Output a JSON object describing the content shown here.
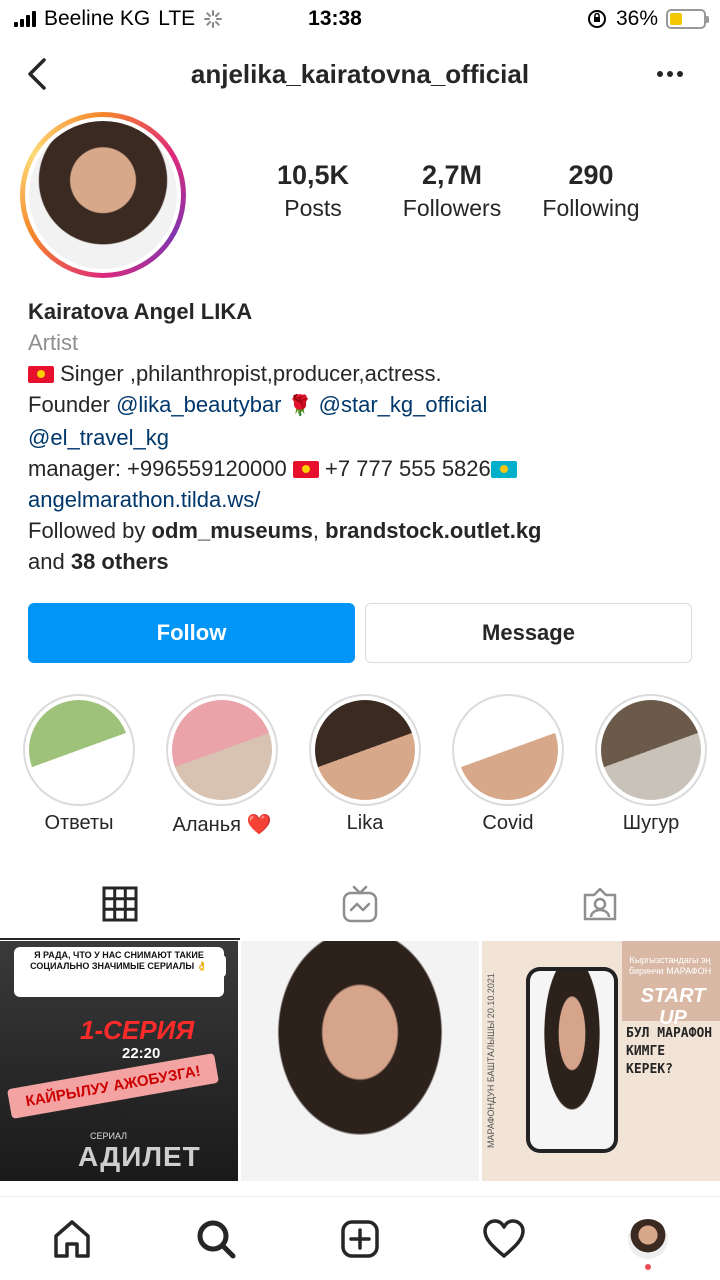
{
  "status_bar": {
    "carrier": "Beeline KG",
    "network": "LTE",
    "time": "13:38",
    "battery": "36%",
    "battery_level": 0.36
  },
  "header": {
    "username": "anjelika_kairatovna_official"
  },
  "stats": [
    {
      "value": "10,5K",
      "label": "Posts"
    },
    {
      "value": "2,7M",
      "label": "Followers"
    },
    {
      "value": "290",
      "label": "Following"
    }
  ],
  "bio": {
    "name": "Kairatova Angel LIKA",
    "category": "Artist",
    "line1": "Singer ,philanthropist,producer,actress.",
    "founder": "Founder",
    "mention1": "@lika_beautybar",
    "mention2": "@star_kg_official",
    "mention3": "@el_travel_kg",
    "manager_prefix": "manager: +996559120000",
    "manager_phone2": "+7 777 555 5826",
    "website": "angelmarathon.tilda.ws/",
    "followed_by_prefix": "Followed by",
    "followed_user1": "odm_museums",
    "followed_user2": "brandstock.outlet.kg",
    "and": "and",
    "others": "38 others"
  },
  "buttons": {
    "follow": "Follow",
    "message": "Message"
  },
  "highlights": [
    {
      "label": "Ответы",
      "colors": [
        "#9fc27a",
        "#ffffff"
      ]
    },
    {
      "label": "Аланья ❤️",
      "colors": [
        "#e9a3a9",
        "#d8c3b3"
      ]
    },
    {
      "label": "Lika",
      "colors": [
        "#3b2a22",
        "#d8a88a"
      ]
    },
    {
      "label": "Covid",
      "colors": [
        "#ffffff",
        "#d8a88a"
      ]
    },
    {
      "label": "Шугур",
      "colors": [
        "#6b5a4a",
        "#c9c2b8"
      ]
    }
  ],
  "posts": {
    "post1": {
      "top_text": "Я РАДА, ЧТО У НАС СНИМАЮТ ТАКИЕ СОЦИАЛЬНО ЗНАЧИМЫЕ СЕРИАЛЫ 👌",
      "episode": "1-СЕРИЯ",
      "time": "22:20",
      "banner": "КАЙРЫЛУУ АЖОБУЗГА!",
      "sub": "СЕРИАЛ",
      "series": "АДИЛЕТ"
    },
    "post3": {
      "vertical": "МАРАФОНДУН БАШТАЛЫШЫ 20.10.2021",
      "top": "Кыргызстандагы эң биринчи МАРАФОН",
      "start": "START UP",
      "question": "БУЛ МАРАФОН КИМГЕ КЕРЕК?"
    }
  }
}
